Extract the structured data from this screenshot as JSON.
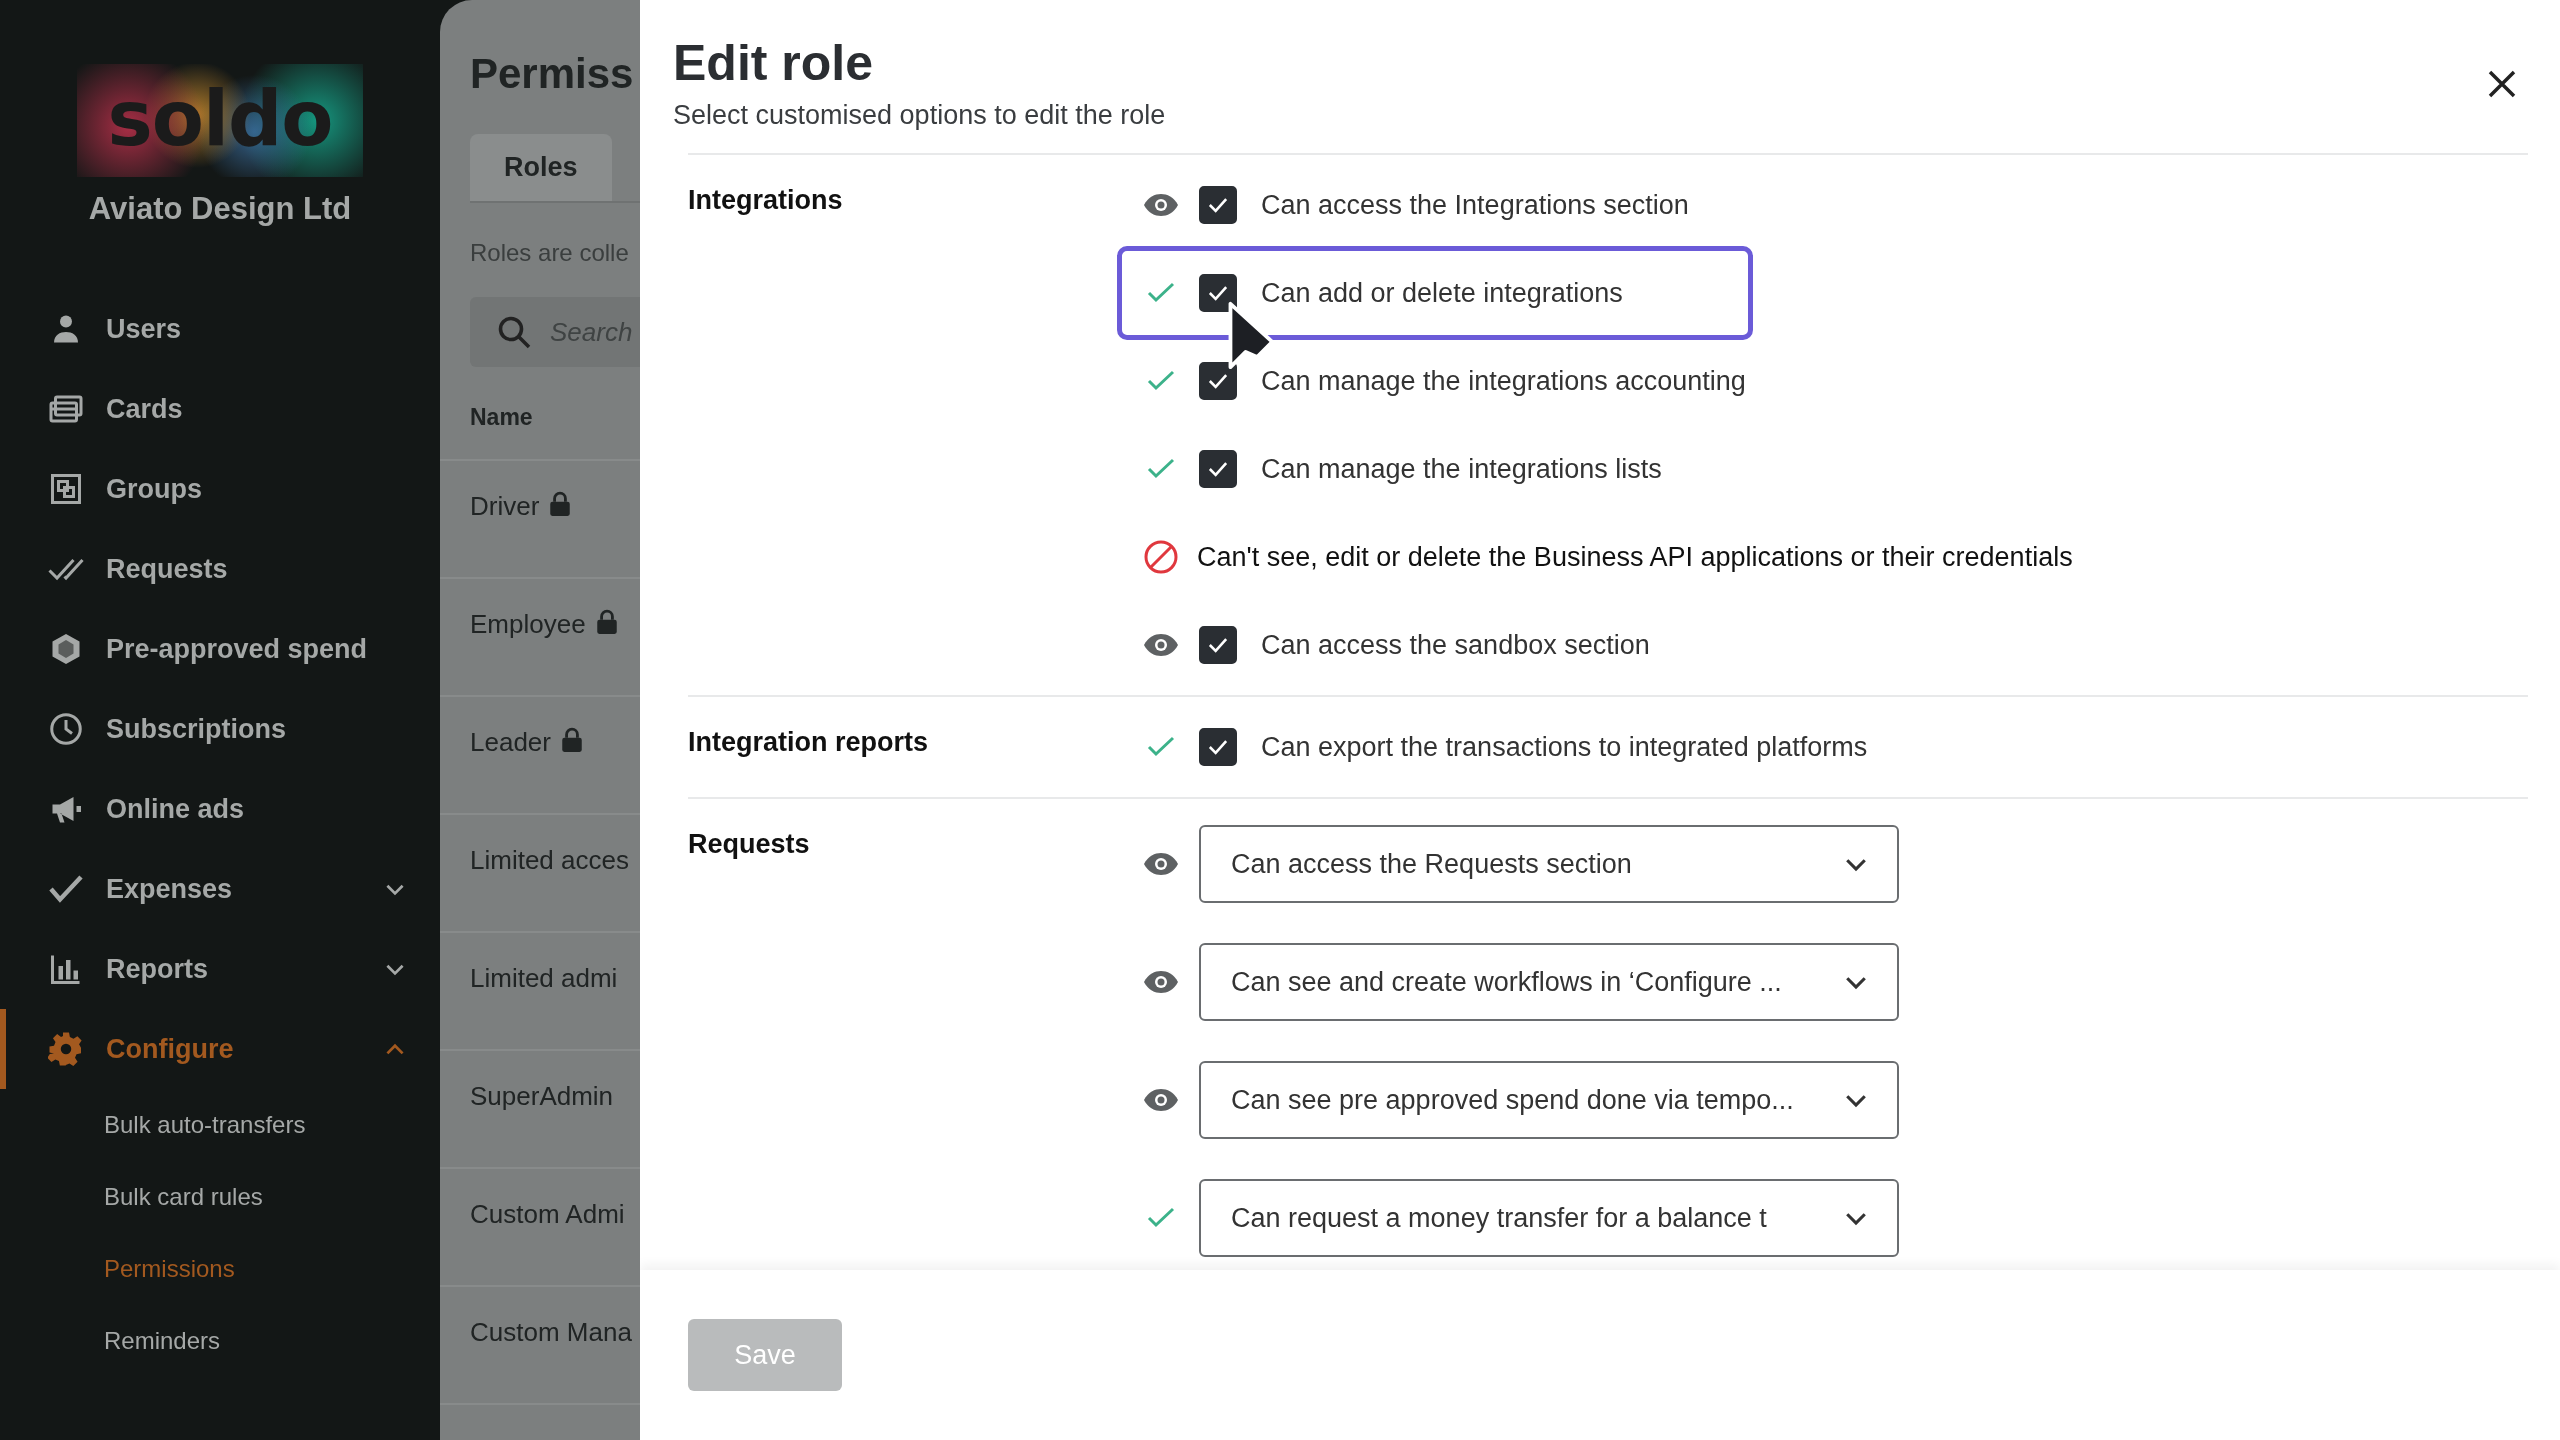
{
  "brand": {
    "logo_text": "soldo",
    "company": "Aviato Design Ltd"
  },
  "sidebar": {
    "items": [
      {
        "label": "Users",
        "selected": false
      },
      {
        "label": "Cards",
        "selected": false
      },
      {
        "label": "Groups",
        "selected": false
      },
      {
        "label": "Requests",
        "selected": false
      },
      {
        "label": "Pre-approved spend",
        "selected": false
      },
      {
        "label": "Subscriptions",
        "selected": false
      },
      {
        "label": "Online ads",
        "selected": false
      },
      {
        "label": "Expenses",
        "selected": false,
        "expanded": false
      },
      {
        "label": "Reports",
        "selected": false,
        "expanded": false
      },
      {
        "label": "Configure",
        "selected": true,
        "expanded": true,
        "children": [
          {
            "label": "Bulk auto-transfers",
            "selected": false
          },
          {
            "label": "Bulk card rules",
            "selected": false
          },
          {
            "label": "Permissions",
            "selected": true
          },
          {
            "label": "Reminders",
            "selected": false
          }
        ]
      }
    ]
  },
  "permissions_page": {
    "title": "Permiss",
    "tabs": [
      {
        "label": "Roles",
        "selected": true
      }
    ],
    "description": "Roles are colle",
    "search": {
      "placeholder": "Search"
    },
    "table": {
      "columns": [
        "Name"
      ],
      "rows": [
        {
          "name": "Driver",
          "locked": true
        },
        {
          "name": "Employee",
          "locked": true
        },
        {
          "name": "Leader",
          "locked": true
        },
        {
          "name": "Limited acces",
          "locked": false
        },
        {
          "name": "Limited admi",
          "locked": false
        },
        {
          "name": "SuperAdmin",
          "locked": false
        },
        {
          "name": "Custom Admi",
          "locked": false
        },
        {
          "name": "Custom Mana",
          "locked": false
        }
      ]
    }
  },
  "dialog": {
    "title": "Edit role",
    "subtitle": "Select customised options to edit the role",
    "sections": [
      {
        "title": "Integrations",
        "options": [
          {
            "kind": "checkbox",
            "granted": false,
            "label": "Can access the Integrations section",
            "checked": true,
            "highlighted": false
          },
          {
            "kind": "checkbox",
            "granted": true,
            "label": "Can add or delete integrations",
            "checked": true,
            "highlighted": true
          },
          {
            "kind": "checkbox",
            "granted": true,
            "label": "Can manage the integrations accounting",
            "checked": true,
            "highlighted": false
          },
          {
            "kind": "checkbox",
            "granted": true,
            "label": "Can manage the integrations lists",
            "checked": true,
            "highlighted": false
          },
          {
            "kind": "denied",
            "label": "Can't see, edit or delete the Business API applications or their credentials"
          },
          {
            "kind": "checkbox",
            "granted": false,
            "label": "Can access the sandbox section",
            "checked": true,
            "highlighted": false
          }
        ]
      },
      {
        "title": "Integration reports",
        "options": [
          {
            "kind": "checkbox",
            "granted": true,
            "label": "Can export the transactions to integrated platforms",
            "checked": true,
            "highlighted": false
          }
        ]
      },
      {
        "title": "Requests",
        "options": [
          {
            "kind": "select",
            "granted": false,
            "value": "Can access the Requests section"
          },
          {
            "kind": "select",
            "granted": false,
            "value": "Can see and create workflows in ‘Configure ..."
          },
          {
            "kind": "select",
            "granted": false,
            "value": "Can see pre approved spend done via tempo..."
          },
          {
            "kind": "select",
            "granted": true,
            "value": "Can request a money transfer for a balance t"
          }
        ]
      }
    ],
    "buttons": [
      {
        "label": "Save",
        "disabled": true
      }
    ]
  }
}
